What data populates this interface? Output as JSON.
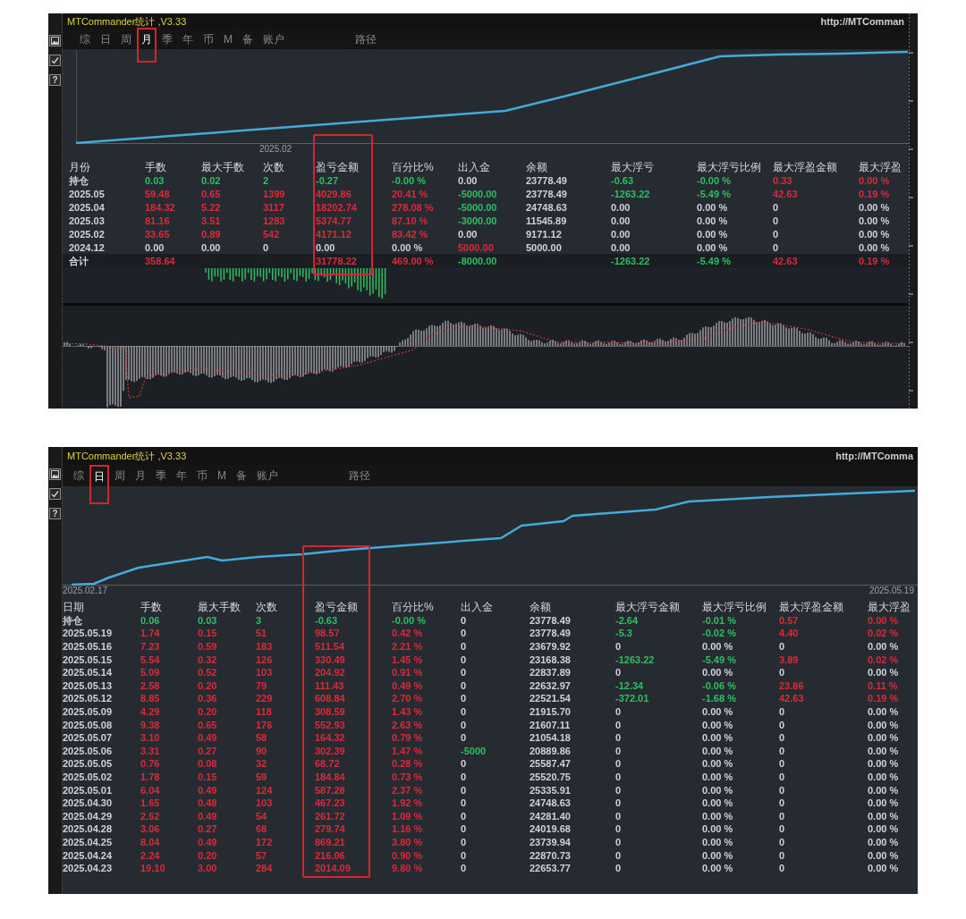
{
  "panels": [
    {
      "title": "MTCommander统计 ,V3.33",
      "url": "http://MTComman",
      "indicator_pane": true,
      "price_axis": true,
      "toolbar": [
        {
          "kind": "picture"
        },
        {
          "kind": "check"
        },
        {
          "kind": "help",
          "label": "?"
        }
      ],
      "tabs": [
        {
          "label": "综",
          "selected": false
        },
        {
          "label": "日",
          "selected": false
        },
        {
          "label": "周",
          "selected": false
        },
        {
          "label": "月",
          "selected": true
        },
        {
          "label": "季",
          "selected": false
        },
        {
          "label": "年",
          "selected": false
        },
        {
          "label": "币",
          "selected": false
        },
        {
          "label": "M",
          "selected": false
        },
        {
          "label": "备",
          "selected": false
        },
        {
          "label": "账户",
          "selected": false
        }
      ],
      "path_button": "路径",
      "chart": {
        "date_labels": [
          "2025.02"
        ]
      },
      "table": {
        "columns": [
          {
            "label": "月份",
            "highlighted": false
          },
          {
            "label": "手数",
            "highlighted": false
          },
          {
            "label": "最大手数",
            "highlighted": false
          },
          {
            "label": "次数",
            "highlighted": false
          },
          {
            "label": "盈亏金额",
            "highlighted": true
          },
          {
            "label": "百分比%",
            "highlighted": false
          },
          {
            "label": "出入金",
            "highlighted": false
          },
          {
            "label": "余额",
            "highlighted": false
          },
          {
            "label": "最大浮亏",
            "highlighted": false
          },
          {
            "label": "最大浮亏比例",
            "highlighted": false
          },
          {
            "label": "最大浮盈金额",
            "highlighted": false
          },
          {
            "label": "最大浮盈",
            "highlighted": false
          }
        ],
        "rows": [
          {
            "kind": "entry",
            "cells": [
              {
                "text": "持仓",
                "color": "#cfd3d8"
              },
              {
                "text": "0.03",
                "color": "#2fbf62"
              },
              {
                "text": "0.02",
                "color": "#2fbf62"
              },
              {
                "text": "2",
                "color": "#2fbf62"
              },
              {
                "text": "-0.27",
                "color": "#2fbf62"
              },
              {
                "text": "-0.00 %",
                "color": "#2fbf62"
              },
              {
                "text": "0.00",
                "color": "#cfd3d8"
              },
              {
                "text": "23778.49",
                "color": "#cfd3d8"
              },
              {
                "text": "-0.63",
                "color": "#2fbf62"
              },
              {
                "text": "-0.00 %",
                "color": "#2fbf62"
              },
              {
                "text": "0.33",
                "color": "#d92b3a"
              },
              {
                "text": "0.00 %",
                "color": "#d92b3a"
              }
            ]
          },
          {
            "kind": "entry",
            "cells": [
              {
                "text": "2025.05",
                "color": "#cfd3d8"
              },
              {
                "text": "59.48",
                "color": "#d92b3a"
              },
              {
                "text": "0.65",
                "color": "#d92b3a"
              },
              {
                "text": "1399",
                "color": "#d92b3a"
              },
              {
                "text": "4029.86",
                "color": "#d92b3a"
              },
              {
                "text": "20.41 %",
                "color": "#d92b3a"
              },
              {
                "text": "-5000.00",
                "color": "#2fbf62"
              },
              {
                "text": "23778.49",
                "color": "#cfd3d8"
              },
              {
                "text": "-1263.22",
                "color": "#2fbf62"
              },
              {
                "text": "-5.49 %",
                "color": "#2fbf62"
              },
              {
                "text": "42.63",
                "color": "#d92b3a"
              },
              {
                "text": "0.19 %",
                "color": "#d92b3a"
              }
            ]
          },
          {
            "kind": "entry",
            "cells": [
              {
                "text": "2025.04",
                "color": "#cfd3d8"
              },
              {
                "text": "184.32",
                "color": "#d92b3a"
              },
              {
                "text": "5.22",
                "color": "#d92b3a"
              },
              {
                "text": "3117",
                "color": "#d92b3a"
              },
              {
                "text": "18202.74",
                "color": "#d92b3a"
              },
              {
                "text": "278.08 %",
                "color": "#d92b3a"
              },
              {
                "text": "-5000.00",
                "color": "#2fbf62"
              },
              {
                "text": "24748.63",
                "color": "#cfd3d8"
              },
              {
                "text": "0.00",
                "color": "#cfd3d8"
              },
              {
                "text": "0.00 %",
                "color": "#cfd3d8"
              },
              {
                "text": "0",
                "color": "#cfd3d8"
              },
              {
                "text": "0.00 %",
                "color": "#cfd3d8"
              }
            ]
          },
          {
            "kind": "entry",
            "cells": [
              {
                "text": "2025.03",
                "color": "#cfd3d8"
              },
              {
                "text": "81.16",
                "color": "#d92b3a"
              },
              {
                "text": "3.51",
                "color": "#d92b3a"
              },
              {
                "text": "1283",
                "color": "#d92b3a"
              },
              {
                "text": "5374.77",
                "color": "#d92b3a"
              },
              {
                "text": "87.10 %",
                "color": "#d92b3a"
              },
              {
                "text": "-3000.00",
                "color": "#2fbf62"
              },
              {
                "text": "11545.89",
                "color": "#cfd3d8"
              },
              {
                "text": "0.00",
                "color": "#cfd3d8"
              },
              {
                "text": "0.00 %",
                "color": "#cfd3d8"
              },
              {
                "text": "0",
                "color": "#cfd3d8"
              },
              {
                "text": "0.00 %",
                "color": "#cfd3d8"
              }
            ]
          },
          {
            "kind": "entry",
            "cells": [
              {
                "text": "2025.02",
                "color": "#cfd3d8"
              },
              {
                "text": "33.65",
                "color": "#d92b3a"
              },
              {
                "text": "0.89",
                "color": "#d92b3a"
              },
              {
                "text": "542",
                "color": "#d92b3a"
              },
              {
                "text": "4171.12",
                "color": "#d92b3a"
              },
              {
                "text": "83.42 %",
                "color": "#d92b3a"
              },
              {
                "text": "0.00",
                "color": "#cfd3d8"
              },
              {
                "text": "9171.12",
                "color": "#cfd3d8"
              },
              {
                "text": "0.00",
                "color": "#cfd3d8"
              },
              {
                "text": "0.00 %",
                "color": "#cfd3d8"
              },
              {
                "text": "0",
                "color": "#cfd3d8"
              },
              {
                "text": "0.00 %",
                "color": "#cfd3d8"
              }
            ]
          },
          {
            "kind": "entry",
            "cells": [
              {
                "text": "2024.12",
                "color": "#cfd3d8"
              },
              {
                "text": "0.00",
                "color": "#cfd3d8"
              },
              {
                "text": "0.00",
                "color": "#cfd3d8"
              },
              {
                "text": "0",
                "color": "#cfd3d8"
              },
              {
                "text": "0.00",
                "color": "#cfd3d8"
              },
              {
                "text": "0.00 %",
                "color": "#cfd3d8"
              },
              {
                "text": "5000.00",
                "color": "#d92b3a"
              },
              {
                "text": "5000.00",
                "color": "#cfd3d8"
              },
              {
                "text": "0.00",
                "color": "#cfd3d8"
              },
              {
                "text": "0.00 %",
                "color": "#cfd3d8"
              },
              {
                "text": "0",
                "color": "#cfd3d8"
              },
              {
                "text": "0.00 %",
                "color": "#cfd3d8"
              }
            ]
          },
          {
            "kind": "total",
            "cells": [
              {
                "text": "合计",
                "color": "#cfd3d8"
              },
              {
                "text": "358.64",
                "color": "#d92b3a"
              },
              null,
              null,
              {
                "text": "31778.22",
                "color": "#d92b3a"
              },
              {
                "text": "469.00 %",
                "color": "#d92b3a"
              },
              {
                "text": "-8000.00",
                "color": "#2fbf62"
              },
              null,
              {
                "text": "-1263.22",
                "color": "#2fbf62"
              },
              {
                "text": "-5.49 %",
                "color": "#2fbf62"
              },
              {
                "text": "42.63",
                "color": "#d92b3a"
              },
              {
                "text": "0.19 %",
                "color": "#d92b3a"
              }
            ]
          }
        ]
      }
    },
    {
      "title": "MTCommander统计 ,V3.33",
      "url": "http://MTComma",
      "indicator_pane": false,
      "price_axis": false,
      "toolbar": [
        {
          "kind": "picture"
        },
        {
          "kind": "check"
        },
        {
          "kind": "help",
          "label": "?"
        }
      ],
      "tabs": [
        {
          "label": "综",
          "selected": false
        },
        {
          "label": "日",
          "selected": true
        },
        {
          "label": "周",
          "selected": false
        },
        {
          "label": "月",
          "selected": false
        },
        {
          "label": "季",
          "selected": false
        },
        {
          "label": "年",
          "selected": false
        },
        {
          "label": "币",
          "selected": false
        },
        {
          "label": "M",
          "selected": false
        },
        {
          "label": "备",
          "selected": false
        },
        {
          "label": "账户",
          "selected": false
        }
      ],
      "path_button": "路径",
      "chart": {
        "date_labels": [
          "2025.02.17",
          "2025.05.19"
        ]
      },
      "table": {
        "columns": [
          {
            "label": "日期",
            "highlighted": false
          },
          {
            "label": "手数",
            "highlighted": false
          },
          {
            "label": "最大手数",
            "highlighted": false
          },
          {
            "label": "次数",
            "highlighted": false
          },
          {
            "label": "盈亏金额",
            "highlighted": true
          },
          {
            "label": "百分比%",
            "highlighted": false
          },
          {
            "label": "出入金",
            "highlighted": false
          },
          {
            "label": "余额",
            "highlighted": false
          },
          {
            "label": "最大浮亏金额",
            "highlighted": false
          },
          {
            "label": "最大浮亏比例",
            "highlighted": false
          },
          {
            "label": "最大浮盈金额",
            "highlighted": false
          },
          {
            "label": "最大浮盈",
            "highlighted": false
          }
        ],
        "rows": [
          {
            "kind": "entry",
            "cells": [
              {
                "text": "持仓",
                "color": "#cfd3d8"
              },
              {
                "text": "0.06",
                "color": "#2fbf62"
              },
              {
                "text": "0.03",
                "color": "#2fbf62"
              },
              {
                "text": "3",
                "color": "#2fbf62"
              },
              {
                "text": "-0.63",
                "color": "#2fbf62"
              },
              {
                "text": "-0.00 %",
                "color": "#2fbf62"
              },
              {
                "text": "0",
                "color": "#cfd3d8"
              },
              {
                "text": "23778.49",
                "color": "#cfd3d8"
              },
              {
                "text": "-2.64",
                "color": "#2fbf62"
              },
              {
                "text": "-0.01 %",
                "color": "#2fbf62"
              },
              {
                "text": "0.57",
                "color": "#d92b3a"
              },
              {
                "text": "0.00 %",
                "color": "#d92b3a"
              }
            ]
          },
          {
            "kind": "entry",
            "cells": [
              {
                "text": "2025.05.19",
                "color": "#cfd3d8"
              },
              {
                "text": "1.74",
                "color": "#d92b3a"
              },
              {
                "text": "0.15",
                "color": "#d92b3a"
              },
              {
                "text": "51",
                "color": "#d92b3a"
              },
              {
                "text": "98.57",
                "color": "#d92b3a"
              },
              {
                "text": "0.42 %",
                "color": "#d92b3a"
              },
              {
                "text": "0",
                "color": "#cfd3d8"
              },
              {
                "text": "23778.49",
                "color": "#cfd3d8"
              },
              {
                "text": "-5.3",
                "color": "#2fbf62"
              },
              {
                "text": "-0.02 %",
                "color": "#2fbf62"
              },
              {
                "text": "4.40",
                "color": "#d92b3a"
              },
              {
                "text": "0.02 %",
                "color": "#d92b3a"
              }
            ]
          },
          {
            "kind": "entry",
            "cells": [
              {
                "text": "2025.05.16",
                "color": "#cfd3d8"
              },
              {
                "text": "7.23",
                "color": "#d92b3a"
              },
              {
                "text": "0.59",
                "color": "#d92b3a"
              },
              {
                "text": "183",
                "color": "#d92b3a"
              },
              {
                "text": "511.54",
                "color": "#d92b3a"
              },
              {
                "text": "2.21 %",
                "color": "#d92b3a"
              },
              {
                "text": "0",
                "color": "#cfd3d8"
              },
              {
                "text": "23679.92",
                "color": "#cfd3d8"
              },
              {
                "text": "0",
                "color": "#cfd3d8"
              },
              {
                "text": "0.00 %",
                "color": "#cfd3d8"
              },
              {
                "text": "0",
                "color": "#cfd3d8"
              },
              {
                "text": "0.00 %",
                "color": "#cfd3d8"
              }
            ]
          },
          {
            "kind": "entry",
            "cells": [
              {
                "text": "2025.05.15",
                "color": "#cfd3d8"
              },
              {
                "text": "5.54",
                "color": "#d92b3a"
              },
              {
                "text": "0.32",
                "color": "#d92b3a"
              },
              {
                "text": "126",
                "color": "#d92b3a"
              },
              {
                "text": "330.49",
                "color": "#d92b3a"
              },
              {
                "text": "1.45 %",
                "color": "#d92b3a"
              },
              {
                "text": "0",
                "color": "#cfd3d8"
              },
              {
                "text": "23168.38",
                "color": "#cfd3d8"
              },
              {
                "text": "-1263.22",
                "color": "#2fbf62"
              },
              {
                "text": "-5.49 %",
                "color": "#2fbf62"
              },
              {
                "text": "3.89",
                "color": "#d92b3a"
              },
              {
                "text": "0.02 %",
                "color": "#d92b3a"
              }
            ]
          },
          {
            "kind": "entry",
            "cells": [
              {
                "text": "2025.05.14",
                "color": "#cfd3d8"
              },
              {
                "text": "5.09",
                "color": "#d92b3a"
              },
              {
                "text": "0.52",
                "color": "#d92b3a"
              },
              {
                "text": "103",
                "color": "#d92b3a"
              },
              {
                "text": "204.92",
                "color": "#d92b3a"
              },
              {
                "text": "0.91 %",
                "color": "#d92b3a"
              },
              {
                "text": "0",
                "color": "#cfd3d8"
              },
              {
                "text": "22837.89",
                "color": "#cfd3d8"
              },
              {
                "text": "0",
                "color": "#cfd3d8"
              },
              {
                "text": "0.00 %",
                "color": "#cfd3d8"
              },
              {
                "text": "0",
                "color": "#cfd3d8"
              },
              {
                "text": "0.00 %",
                "color": "#cfd3d8"
              }
            ]
          },
          {
            "kind": "entry",
            "cells": [
              {
                "text": "2025.05.13",
                "color": "#cfd3d8"
              },
              {
                "text": "2.58",
                "color": "#d92b3a"
              },
              {
                "text": "0.20",
                "color": "#d92b3a"
              },
              {
                "text": "79",
                "color": "#d92b3a"
              },
              {
                "text": "111.43",
                "color": "#d92b3a"
              },
              {
                "text": "0.49 %",
                "color": "#d92b3a"
              },
              {
                "text": "0",
                "color": "#cfd3d8"
              },
              {
                "text": "22632.97",
                "color": "#cfd3d8"
              },
              {
                "text": "-12.34",
                "color": "#2fbf62"
              },
              {
                "text": "-0.06 %",
                "color": "#2fbf62"
              },
              {
                "text": "23.86",
                "color": "#d92b3a"
              },
              {
                "text": "0.11 %",
                "color": "#d92b3a"
              }
            ]
          },
          {
            "kind": "entry",
            "cells": [
              {
                "text": "2025.05.12",
                "color": "#cfd3d8"
              },
              {
                "text": "8.85",
                "color": "#d92b3a"
              },
              {
                "text": "0.36",
                "color": "#d92b3a"
              },
              {
                "text": "229",
                "color": "#d92b3a"
              },
              {
                "text": "608.84",
                "color": "#d92b3a"
              },
              {
                "text": "2.70 %",
                "color": "#d92b3a"
              },
              {
                "text": "0",
                "color": "#cfd3d8"
              },
              {
                "text": "22521.54",
                "color": "#cfd3d8"
              },
              {
                "text": "-372.01",
                "color": "#2fbf62"
              },
              {
                "text": "-1.68 %",
                "color": "#2fbf62"
              },
              {
                "text": "42.63",
                "color": "#d92b3a"
              },
              {
                "text": "0.19 %",
                "color": "#d92b3a"
              }
            ]
          },
          {
            "kind": "entry",
            "cells": [
              {
                "text": "2025.05.09",
                "color": "#cfd3d8"
              },
              {
                "text": "4.29",
                "color": "#d92b3a"
              },
              {
                "text": "0.20",
                "color": "#d92b3a"
              },
              {
                "text": "118",
                "color": "#d92b3a"
              },
              {
                "text": "308.59",
                "color": "#d92b3a"
              },
              {
                "text": "1.43 %",
                "color": "#d92b3a"
              },
              {
                "text": "0",
                "color": "#cfd3d8"
              },
              {
                "text": "21915.70",
                "color": "#cfd3d8"
              },
              {
                "text": "0",
                "color": "#cfd3d8"
              },
              {
                "text": "0.00 %",
                "color": "#cfd3d8"
              },
              {
                "text": "0",
                "color": "#cfd3d8"
              },
              {
                "text": "0.00 %",
                "color": "#cfd3d8"
              }
            ]
          },
          {
            "kind": "entry",
            "cells": [
              {
                "text": "2025.05.08",
                "color": "#cfd3d8"
              },
              {
                "text": "9.38",
                "color": "#d92b3a"
              },
              {
                "text": "0.65",
                "color": "#d92b3a"
              },
              {
                "text": "176",
                "color": "#d92b3a"
              },
              {
                "text": "552.93",
                "color": "#d92b3a"
              },
              {
                "text": "2.63 %",
                "color": "#d92b3a"
              },
              {
                "text": "0",
                "color": "#cfd3d8"
              },
              {
                "text": "21607.11",
                "color": "#cfd3d8"
              },
              {
                "text": "0",
                "color": "#cfd3d8"
              },
              {
                "text": "0.00 %",
                "color": "#cfd3d8"
              },
              {
                "text": "0",
                "color": "#cfd3d8"
              },
              {
                "text": "0.00 %",
                "color": "#cfd3d8"
              }
            ]
          },
          {
            "kind": "entry",
            "cells": [
              {
                "text": "2025.05.07",
                "color": "#cfd3d8"
              },
              {
                "text": "3.10",
                "color": "#d92b3a"
              },
              {
                "text": "0.49",
                "color": "#d92b3a"
              },
              {
                "text": "58",
                "color": "#d92b3a"
              },
              {
                "text": "164.32",
                "color": "#d92b3a"
              },
              {
                "text": "0.79 %",
                "color": "#d92b3a"
              },
              {
                "text": "0",
                "color": "#cfd3d8"
              },
              {
                "text": "21054.18",
                "color": "#cfd3d8"
              },
              {
                "text": "0",
                "color": "#cfd3d8"
              },
              {
                "text": "0.00 %",
                "color": "#cfd3d8"
              },
              {
                "text": "0",
                "color": "#cfd3d8"
              },
              {
                "text": "0.00 %",
                "color": "#cfd3d8"
              }
            ]
          },
          {
            "kind": "entry",
            "cells": [
              {
                "text": "2025.05.06",
                "color": "#cfd3d8"
              },
              {
                "text": "3.31",
                "color": "#d92b3a"
              },
              {
                "text": "0.27",
                "color": "#d92b3a"
              },
              {
                "text": "90",
                "color": "#d92b3a"
              },
              {
                "text": "302.39",
                "color": "#d92b3a"
              },
              {
                "text": "1.47 %",
                "color": "#d92b3a"
              },
              {
                "text": "-5000",
                "color": "#2fbf62"
              },
              {
                "text": "20889.86",
                "color": "#cfd3d8"
              },
              {
                "text": "0",
                "color": "#cfd3d8"
              },
              {
                "text": "0.00 %",
                "color": "#cfd3d8"
              },
              {
                "text": "0",
                "color": "#cfd3d8"
              },
              {
                "text": "0.00 %",
                "color": "#cfd3d8"
              }
            ]
          },
          {
            "kind": "entry",
            "cells": [
              {
                "text": "2025.05.05",
                "color": "#cfd3d8"
              },
              {
                "text": "0.76",
                "color": "#d92b3a"
              },
              {
                "text": "0.08",
                "color": "#d92b3a"
              },
              {
                "text": "32",
                "color": "#d92b3a"
              },
              {
                "text": "68.72",
                "color": "#d92b3a"
              },
              {
                "text": "0.28 %",
                "color": "#d92b3a"
              },
              {
                "text": "0",
                "color": "#cfd3d8"
              },
              {
                "text": "25587.47",
                "color": "#cfd3d8"
              },
              {
                "text": "0",
                "color": "#cfd3d8"
              },
              {
                "text": "0.00 %",
                "color": "#cfd3d8"
              },
              {
                "text": "0",
                "color": "#cfd3d8"
              },
              {
                "text": "0.00 %",
                "color": "#cfd3d8"
              }
            ]
          },
          {
            "kind": "entry",
            "cells": [
              {
                "text": "2025.05.02",
                "color": "#cfd3d8"
              },
              {
                "text": "1.78",
                "color": "#d92b3a"
              },
              {
                "text": "0.15",
                "color": "#d92b3a"
              },
              {
                "text": "59",
                "color": "#d92b3a"
              },
              {
                "text": "184.84",
                "color": "#d92b3a"
              },
              {
                "text": "0.73 %",
                "color": "#d92b3a"
              },
              {
                "text": "0",
                "color": "#cfd3d8"
              },
              {
                "text": "25520.75",
                "color": "#cfd3d8"
              },
              {
                "text": "0",
                "color": "#cfd3d8"
              },
              {
                "text": "0.00 %",
                "color": "#cfd3d8"
              },
              {
                "text": "0",
                "color": "#cfd3d8"
              },
              {
                "text": "0.00 %",
                "color": "#cfd3d8"
              }
            ]
          },
          {
            "kind": "entry",
            "cells": [
              {
                "text": "2025.05.01",
                "color": "#cfd3d8"
              },
              {
                "text": "6.04",
                "color": "#d92b3a"
              },
              {
                "text": "0.49",
                "color": "#d92b3a"
              },
              {
                "text": "124",
                "color": "#d92b3a"
              },
              {
                "text": "587.28",
                "color": "#d92b3a"
              },
              {
                "text": "2.37 %",
                "color": "#d92b3a"
              },
              {
                "text": "0",
                "color": "#cfd3d8"
              },
              {
                "text": "25335.91",
                "color": "#cfd3d8"
              },
              {
                "text": "0",
                "color": "#cfd3d8"
              },
              {
                "text": "0.00 %",
                "color": "#cfd3d8"
              },
              {
                "text": "0",
                "color": "#cfd3d8"
              },
              {
                "text": "0.00 %",
                "color": "#cfd3d8"
              }
            ]
          },
          {
            "kind": "entry",
            "cells": [
              {
                "text": "2025.04.30",
                "color": "#cfd3d8"
              },
              {
                "text": "1.65",
                "color": "#d92b3a"
              },
              {
                "text": "0.48",
                "color": "#d92b3a"
              },
              {
                "text": "103",
                "color": "#d92b3a"
              },
              {
                "text": "467.23",
                "color": "#d92b3a"
              },
              {
                "text": "1.92 %",
                "color": "#d92b3a"
              },
              {
                "text": "0",
                "color": "#cfd3d8"
              },
              {
                "text": "24748.63",
                "color": "#cfd3d8"
              },
              {
                "text": "0",
                "color": "#cfd3d8"
              },
              {
                "text": "0.00 %",
                "color": "#cfd3d8"
              },
              {
                "text": "0",
                "color": "#cfd3d8"
              },
              {
                "text": "0.00 %",
                "color": "#cfd3d8"
              }
            ]
          },
          {
            "kind": "entry",
            "cells": [
              {
                "text": "2025.04.29",
                "color": "#cfd3d8"
              },
              {
                "text": "2.52",
                "color": "#d92b3a"
              },
              {
                "text": "0.49",
                "color": "#d92b3a"
              },
              {
                "text": "54",
                "color": "#d92b3a"
              },
              {
                "text": "261.72",
                "color": "#d92b3a"
              },
              {
                "text": "1.09 %",
                "color": "#d92b3a"
              },
              {
                "text": "0",
                "color": "#cfd3d8"
              },
              {
                "text": "24281.40",
                "color": "#cfd3d8"
              },
              {
                "text": "0",
                "color": "#cfd3d8"
              },
              {
                "text": "0.00 %",
                "color": "#cfd3d8"
              },
              {
                "text": "0",
                "color": "#cfd3d8"
              },
              {
                "text": "0.00 %",
                "color": "#cfd3d8"
              }
            ]
          },
          {
            "kind": "entry",
            "cells": [
              {
                "text": "2025.04.28",
                "color": "#cfd3d8"
              },
              {
                "text": "3.06",
                "color": "#d92b3a"
              },
              {
                "text": "0.27",
                "color": "#d92b3a"
              },
              {
                "text": "68",
                "color": "#d92b3a"
              },
              {
                "text": "279.74",
                "color": "#d92b3a"
              },
              {
                "text": "1.16 %",
                "color": "#d92b3a"
              },
              {
                "text": "0",
                "color": "#cfd3d8"
              },
              {
                "text": "24019.68",
                "color": "#cfd3d8"
              },
              {
                "text": "0",
                "color": "#cfd3d8"
              },
              {
                "text": "0.00 %",
                "color": "#cfd3d8"
              },
              {
                "text": "0",
                "color": "#cfd3d8"
              },
              {
                "text": "0.00 %",
                "color": "#cfd3d8"
              }
            ]
          },
          {
            "kind": "entry",
            "cells": [
              {
                "text": "2025.04.25",
                "color": "#cfd3d8"
              },
              {
                "text": "8.04",
                "color": "#d92b3a"
              },
              {
                "text": "0.49",
                "color": "#d92b3a"
              },
              {
                "text": "172",
                "color": "#d92b3a"
              },
              {
                "text": "869.21",
                "color": "#d92b3a"
              },
              {
                "text": "3.80 %",
                "color": "#d92b3a"
              },
              {
                "text": "0",
                "color": "#cfd3d8"
              },
              {
                "text": "23739.94",
                "color": "#cfd3d8"
              },
              {
                "text": "0",
                "color": "#cfd3d8"
              },
              {
                "text": "0.00 %",
                "color": "#cfd3d8"
              },
              {
                "text": "0",
                "color": "#cfd3d8"
              },
              {
                "text": "0.00 %",
                "color": "#cfd3d8"
              }
            ]
          },
          {
            "kind": "entry",
            "cells": [
              {
                "text": "2025.04.24",
                "color": "#cfd3d8"
              },
              {
                "text": "2.24",
                "color": "#d92b3a"
              },
              {
                "text": "0.20",
                "color": "#d92b3a"
              },
              {
                "text": "57",
                "color": "#d92b3a"
              },
              {
                "text": "216.06",
                "color": "#d92b3a"
              },
              {
                "text": "0.90 %",
                "color": "#d92b3a"
              },
              {
                "text": "0",
                "color": "#cfd3d8"
              },
              {
                "text": "22870.73",
                "color": "#cfd3d8"
              },
              {
                "text": "0",
                "color": "#cfd3d8"
              },
              {
                "text": "0.00 %",
                "color": "#cfd3d8"
              },
              {
                "text": "0",
                "color": "#cfd3d8"
              },
              {
                "text": "0.00 %",
                "color": "#cfd3d8"
              }
            ]
          },
          {
            "kind": "entry",
            "cells": [
              {
                "text": "2025.04.23",
                "color": "#cfd3d8"
              },
              {
                "text": "19.10",
                "color": "#d92b3a"
              },
              {
                "text": "3.00",
                "color": "#d92b3a"
              },
              {
                "text": "284",
                "color": "#d92b3a"
              },
              {
                "text": "2014.09",
                "color": "#d92b3a"
              },
              {
                "text": "9.80 %",
                "color": "#d92b3a"
              },
              {
                "text": "0",
                "color": "#cfd3d8"
              },
              {
                "text": "22653.77",
                "color": "#cfd3d8"
              },
              {
                "text": "0",
                "color": "#cfd3d8"
              },
              {
                "text": "0.00 %",
                "color": "#cfd3d8"
              },
              {
                "text": "0",
                "color": "#cfd3d8"
              },
              {
                "text": "0.00 %",
                "color": "#cfd3d8"
              }
            ]
          }
        ]
      }
    }
  ]
}
